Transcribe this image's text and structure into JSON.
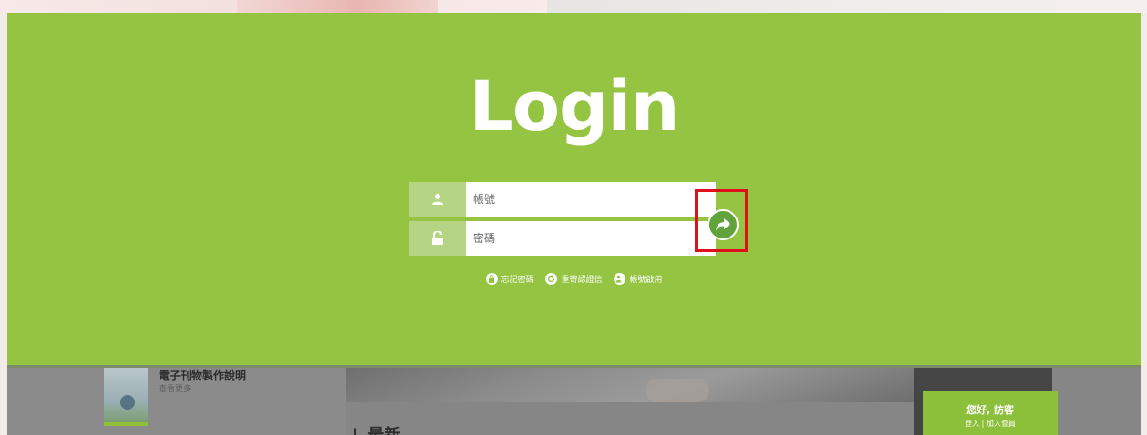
{
  "login": {
    "title": "Login",
    "username_placeholder": "帳號",
    "password_placeholder": "密碼",
    "links": [
      {
        "label": "忘記密碼",
        "icon": "lock-icon"
      },
      {
        "label": "重寄認證信",
        "icon": "refresh-icon"
      },
      {
        "label": "帳號啟用",
        "icon": "user-check-icon"
      }
    ]
  },
  "background": {
    "book_title": "電子刊物製作說明",
    "book_subtitle": "查看更多",
    "section_heading": "最新",
    "user_greeting": "您好, 訪客",
    "user_links": "登入 | 加入會員"
  },
  "colors": {
    "overlay_green": "#95c442",
    "icon_box_green": "#b5d585",
    "submit_green": "#5fa33a",
    "highlight_red": "#e0101a"
  }
}
